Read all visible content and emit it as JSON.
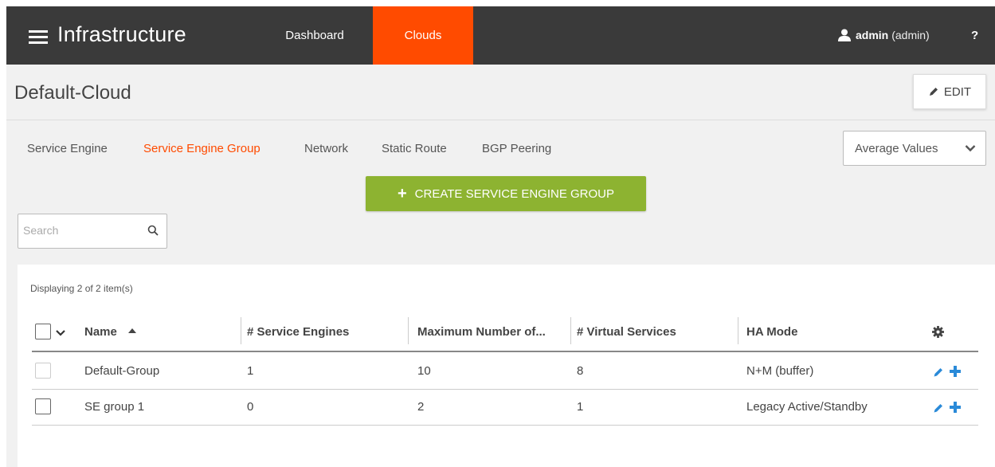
{
  "topbar": {
    "app_title": "Infrastructure",
    "nav": {
      "dashboard": "Dashboard",
      "clouds": "Clouds"
    },
    "user_name": "admin",
    "user_role": "(admin)",
    "help": "?"
  },
  "header": {
    "title": "Default-Cloud",
    "edit_label": "EDIT"
  },
  "subnav": {
    "service_engine": "Service Engine",
    "service_engine_group": "Service Engine Group",
    "network": "Network",
    "static_route": "Static Route",
    "bgp_peering": "BGP Peering"
  },
  "values_select": {
    "selected": "Average Values"
  },
  "create_button": {
    "label": "CREATE SERVICE ENGINE GROUP"
  },
  "search": {
    "placeholder": "Search",
    "value": ""
  },
  "table": {
    "displaying": "Displaying 2 of 2 item(s)",
    "columns": {
      "name": "Name",
      "service_engines": "# Service Engines",
      "max_number": "Maximum Number of...",
      "virtual_services": "# Virtual Services",
      "ha_mode": "HA Mode"
    },
    "rows": [
      {
        "name": "Default-Group",
        "service_engines": "1",
        "max_number": "10",
        "virtual_services": "8",
        "ha_mode": "N+M (buffer)"
      },
      {
        "name": "SE group 1",
        "service_engines": "0",
        "max_number": "2",
        "virtual_services": "1",
        "ha_mode": "Legacy Active/Standby"
      }
    ]
  },
  "colors": {
    "accent": "#ff4b00",
    "topbar": "#3a3a3a",
    "create": "#8db331",
    "action_icon": "#2a8ad8"
  }
}
